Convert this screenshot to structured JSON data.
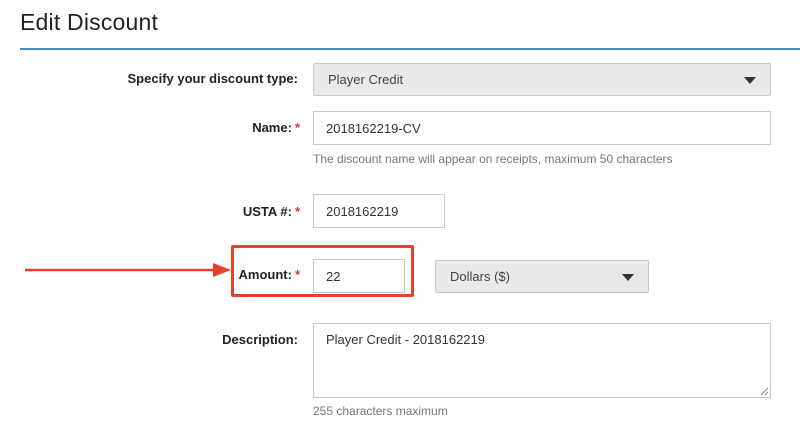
{
  "page": {
    "title": "Edit Discount"
  },
  "form": {
    "discount_type": {
      "label": "Specify your discount type:",
      "value": "Player Credit"
    },
    "name": {
      "label": "Name:",
      "required_mark": "*",
      "value": "2018162219-CV",
      "help": "The discount name will appear on receipts, maximum 50 characters"
    },
    "usta": {
      "label": "USTA #:",
      "required_mark": "*",
      "value": "2018162219"
    },
    "amount": {
      "label": "Amount:",
      "required_mark": "*",
      "value": "22",
      "unit": "Dollars ($)"
    },
    "description": {
      "label": "Description:",
      "value": "Player Credit - 2018162219",
      "help": "255 characters maximum"
    }
  },
  "colors": {
    "accent_rule": "#4a8ec5",
    "annotation": "#e8402a",
    "required": "#e3342f"
  },
  "icons": {
    "dropdown": "caret-down-icon",
    "annotation": "arrow-right-icon"
  }
}
